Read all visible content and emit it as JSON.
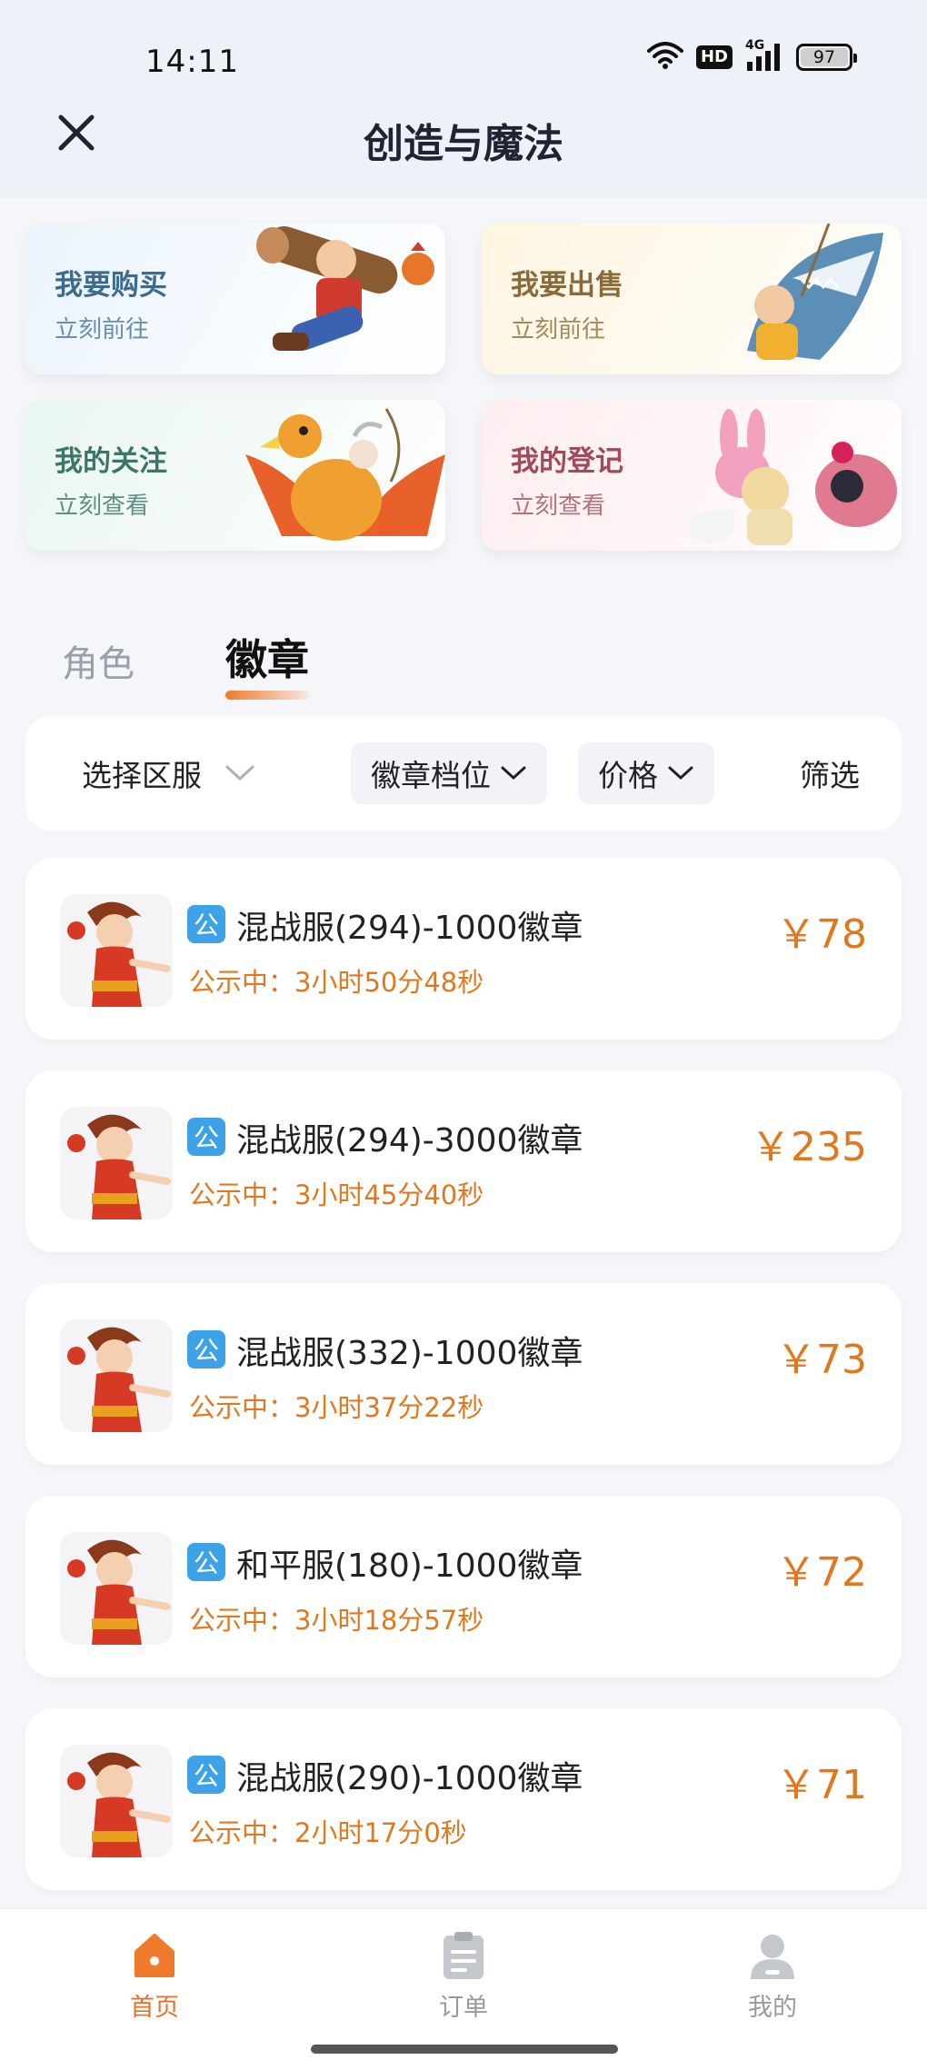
{
  "status_bar": {
    "time": "14:11",
    "hd": "HD",
    "network": "4G",
    "battery": "97"
  },
  "header": {
    "title": "创造与魔法"
  },
  "entry_cards": [
    {
      "title": "我要购买",
      "sub": "立刻前往"
    },
    {
      "title": "我要出售",
      "sub": "立刻前往"
    },
    {
      "title": "我的关注",
      "sub": "立刻查看"
    },
    {
      "title": "我的登记",
      "sub": "立刻查看"
    }
  ],
  "tabs": [
    {
      "label": "角色",
      "active": false
    },
    {
      "label": "徽章",
      "active": true
    }
  ],
  "filters": {
    "server": "选择区服",
    "tier": "徽章档位",
    "price": "价格",
    "filter": "筛选"
  },
  "listings": [
    {
      "tag": "公",
      "title": "混战服(294)-1000徽章",
      "status": "公示中：3小时50分48秒",
      "price": "￥78"
    },
    {
      "tag": "公",
      "title": "混战服(294)-3000徽章",
      "status": "公示中：3小时45分40秒",
      "price": "￥235"
    },
    {
      "tag": "公",
      "title": "混战服(332)-1000徽章",
      "status": "公示中：3小时37分22秒",
      "price": "￥73"
    },
    {
      "tag": "公",
      "title": "和平服(180)-1000徽章",
      "status": "公示中：3小时18分57秒",
      "price": "￥72"
    },
    {
      "tag": "公",
      "title": "混战服(290)-1000徽章",
      "status": "公示中：2小时17分0秒",
      "price": "￥71"
    }
  ],
  "bottom_nav": [
    {
      "label": "首页",
      "active": true
    },
    {
      "label": "订单",
      "active": false
    },
    {
      "label": "我的",
      "active": false
    }
  ],
  "colors": {
    "accent": "#e07820",
    "tag_blue": "#3ea2e8",
    "nav_active": "#e8702a"
  }
}
